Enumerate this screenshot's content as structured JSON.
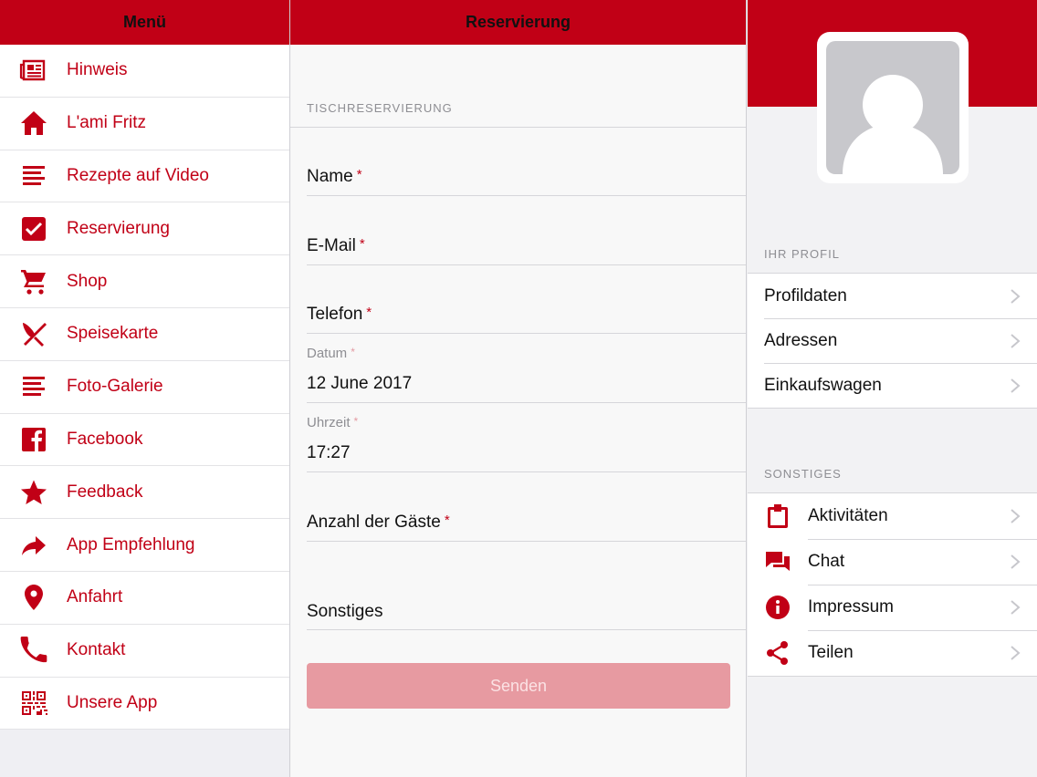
{
  "colors": {
    "accent": "#c10016",
    "button_disabled": "#e79aa1"
  },
  "menu": {
    "title": "Menü",
    "items": [
      {
        "label": "Hinweis",
        "icon": "newspaper-icon"
      },
      {
        "label": "L'ami Fritz",
        "icon": "home-icon"
      },
      {
        "label": "Rezepte auf Video",
        "icon": "lines-icon"
      },
      {
        "label": "Reservierung",
        "icon": "checkbox-icon"
      },
      {
        "label": "Shop",
        "icon": "cart-icon"
      },
      {
        "label": "Speisekarte",
        "icon": "cutlery-icon"
      },
      {
        "label": "Foto-Galerie",
        "icon": "lines-icon"
      },
      {
        "label": "Facebook",
        "icon": "facebook-icon"
      },
      {
        "label": "Feedback",
        "icon": "star-icon"
      },
      {
        "label": "App Empfehlung",
        "icon": "share-arrow-icon"
      },
      {
        "label": "Anfahrt",
        "icon": "map-pin-icon"
      },
      {
        "label": "Kontakt",
        "icon": "phone-icon"
      },
      {
        "label": "Unsere App",
        "icon": "qr-code-icon"
      }
    ]
  },
  "form": {
    "title": "Reservierung",
    "section": "TISCHRESERVIERUNG",
    "required_mark": "*",
    "name_label": "Name",
    "email_label": "E-Mail",
    "phone_label": "Telefon",
    "date_label": "Datum",
    "date_value": "12 June 2017",
    "time_label": "Uhrzeit",
    "time_value": "17:27",
    "guests_label": "Anzahl der Gäste",
    "other_label": "Sonstiges",
    "submit_label": "Senden"
  },
  "profile": {
    "section_profile": "IHR PROFIL",
    "profile_items": [
      "Profildaten",
      "Adressen",
      "Einkaufswagen"
    ],
    "section_other": "SONSTIGES",
    "other_items": [
      {
        "label": "Aktivitäten",
        "icon": "clipboard-icon"
      },
      {
        "label": "Chat",
        "icon": "chat-icon"
      },
      {
        "label": "Impressum",
        "icon": "info-icon"
      },
      {
        "label": "Teilen",
        "icon": "share-icon"
      }
    ]
  }
}
